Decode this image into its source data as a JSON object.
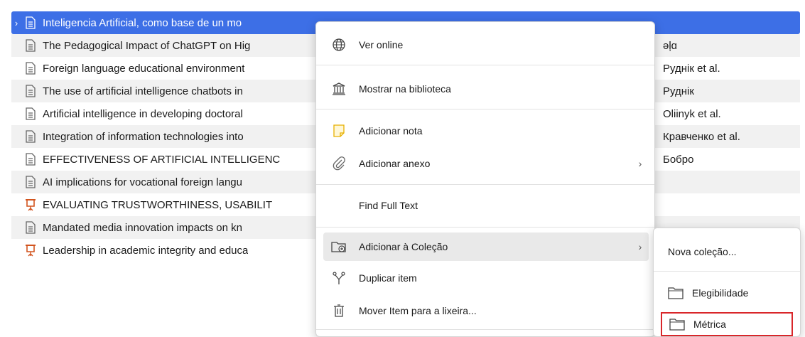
{
  "items": [
    {
      "title": "Inteligencia Artificial, como base de un mo",
      "creator": "",
      "icon": "document-icon",
      "selected": true
    },
    {
      "title": "The Pedagogical Impact of ChatGPT on Hig",
      "creator": "ǝļɑ",
      "icon": "document-icon"
    },
    {
      "title": "Foreign language educational environment",
      "creator": "Руднік et al.",
      "icon": "document-icon"
    },
    {
      "title": "The use of artificial intelligence chatbots in",
      "creator": "Руднік",
      "icon": "document-icon"
    },
    {
      "title": "Artificial intelligence in developing doctoral",
      "creator": "Oliinyk et al.",
      "icon": "document-icon"
    },
    {
      "title": "Integration of information technologies into",
      "creator": "Кравченко et al.",
      "icon": "document-icon"
    },
    {
      "title": "EFFECTIVENESS OF ARTIFICIAL INTELLIGENC",
      "creator": "Бобро",
      "icon": "document-icon"
    },
    {
      "title": "AI implications for vocational foreign langu",
      "creator": "",
      "icon": "document-icon"
    },
    {
      "title": "EVALUATING TRUSTWORTHINESS, USABILIT",
      "creator": "",
      "icon": "presentation-icon"
    },
    {
      "title": "Mandated media innovation impacts on kn",
      "creator": "",
      "icon": "document-icon"
    },
    {
      "title": "Leadership in academic integrity and educa",
      "creator": "",
      "icon": "presentation-icon"
    }
  ],
  "context_menu": {
    "view_online": "Ver online",
    "show_in_library": "Mostrar na biblioteca",
    "add_note": "Adicionar nota",
    "add_attachment": "Adicionar anexo",
    "find_full_text": "Find Full Text",
    "add_to_collection": "Adicionar à Coleção",
    "duplicate_item": "Duplicar item",
    "move_to_trash": "Mover Item para a lixeira..."
  },
  "submenu": {
    "new_collection": "Nova coleção...",
    "collections": [
      "Elegibilidade",
      "Métrica"
    ]
  },
  "colors": {
    "selection": "#3d6fe6",
    "highlight_box": "#d9262a",
    "presentation_icon": "#d2541e"
  }
}
